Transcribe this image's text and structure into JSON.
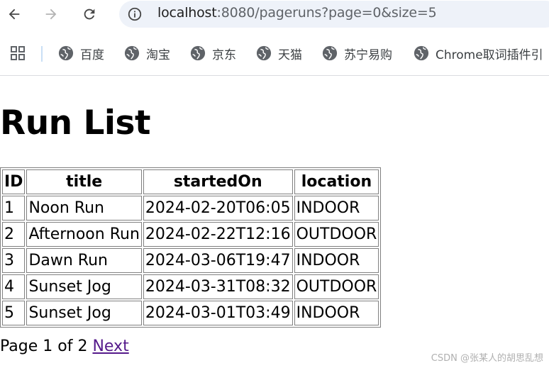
{
  "browser": {
    "url_host": "localhost",
    "url_rest": ":8080/pageruns?page=0&size=5",
    "bookmarks": [
      {
        "label": "百度",
        "icon": "globe-icon"
      },
      {
        "label": "淘宝",
        "icon": "globe-icon"
      },
      {
        "label": "京东",
        "icon": "globe-icon"
      },
      {
        "label": "天猫",
        "icon": "globe-icon"
      },
      {
        "label": "苏宁易购",
        "icon": "globe-icon"
      },
      {
        "label": "Chrome取词插件引",
        "icon": "globe-icon"
      }
    ]
  },
  "page": {
    "title": "Run List",
    "table": {
      "headers": [
        "ID",
        "title",
        "startedOn",
        "location"
      ],
      "rows": [
        [
          "1",
          "Noon Run",
          "2024-02-20T06:05",
          "INDOOR"
        ],
        [
          "2",
          "Afternoon Run",
          "2024-02-22T12:16",
          "OUTDOOR"
        ],
        [
          "3",
          "Dawn Run",
          "2024-03-06T19:47",
          "INDOOR"
        ],
        [
          "4",
          "Sunset Jog",
          "2024-03-31T08:32",
          "OUTDOOR"
        ],
        [
          "5",
          "Sunset Jog",
          "2024-03-01T03:49",
          "INDOOR"
        ]
      ]
    },
    "pagination_text": "Page 1 of 2",
    "next_label": "Next"
  },
  "watermark": "CSDN @张某人的胡思乱想",
  "colors": {
    "link_visited": "#551a8b",
    "omnibox_bg": "#eef2f9",
    "table_border": "#808080"
  }
}
